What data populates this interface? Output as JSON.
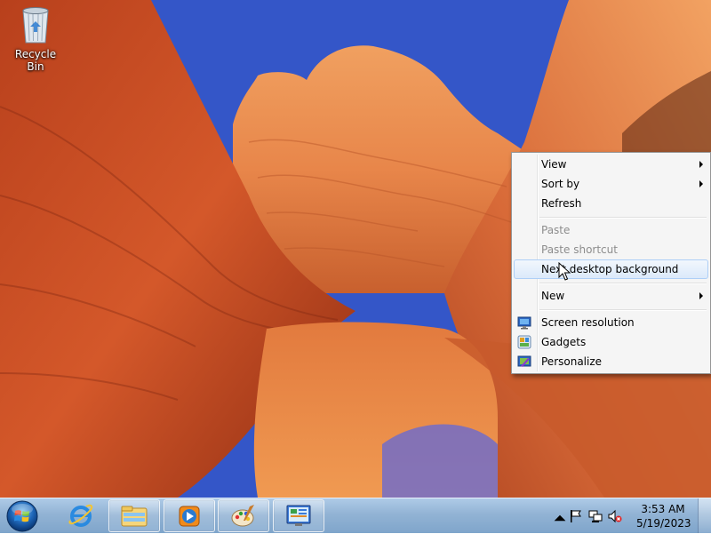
{
  "desktop": {
    "icons": [
      {
        "label": "Recycle Bin",
        "icon": "recycle-bin-icon"
      }
    ]
  },
  "context_menu": {
    "items": [
      {
        "label": "View",
        "submenu": true,
        "disabled": false
      },
      {
        "label": "Sort by",
        "submenu": true,
        "disabled": false
      },
      {
        "label": "Refresh",
        "submenu": false,
        "disabled": false
      },
      {
        "label": "Paste",
        "submenu": false,
        "disabled": true
      },
      {
        "label": "Paste shortcut",
        "submenu": false,
        "disabled": true
      },
      {
        "label": "Next desktop background",
        "submenu": false,
        "disabled": false,
        "highlighted": true
      },
      {
        "label": "New",
        "submenu": true,
        "disabled": false
      },
      {
        "label": "Screen resolution",
        "icon": "monitor-icon",
        "disabled": false
      },
      {
        "label": "Gadgets",
        "icon": "gadgets-icon",
        "disabled": false
      },
      {
        "label": "Personalize",
        "icon": "personalize-icon",
        "disabled": false
      }
    ]
  },
  "taskbar": {
    "start": {
      "icon": "windows-start-orb-icon"
    },
    "pinned": [
      {
        "icon": "internet-explorer-icon",
        "active": false
      },
      {
        "icon": "windows-explorer-icon",
        "active": true
      },
      {
        "icon": "windows-media-player-icon",
        "active": true
      },
      {
        "icon": "paint-icon",
        "active": true
      },
      {
        "icon": "control-panel-icon",
        "active": true
      }
    ],
    "tray": {
      "icons": [
        "show-hidden-icons-chevron",
        "action-center-flag-icon",
        "network-icon",
        "volume-muted-icon"
      ],
      "time": "3:53 AM",
      "date": "5/19/2023"
    }
  },
  "colors": {
    "menu_bg": "#f5f5f5",
    "menu_highlight": "#dbe9fa",
    "menu_disabled_text": "#8d8d8d",
    "taskbar": "#8cafd2"
  }
}
